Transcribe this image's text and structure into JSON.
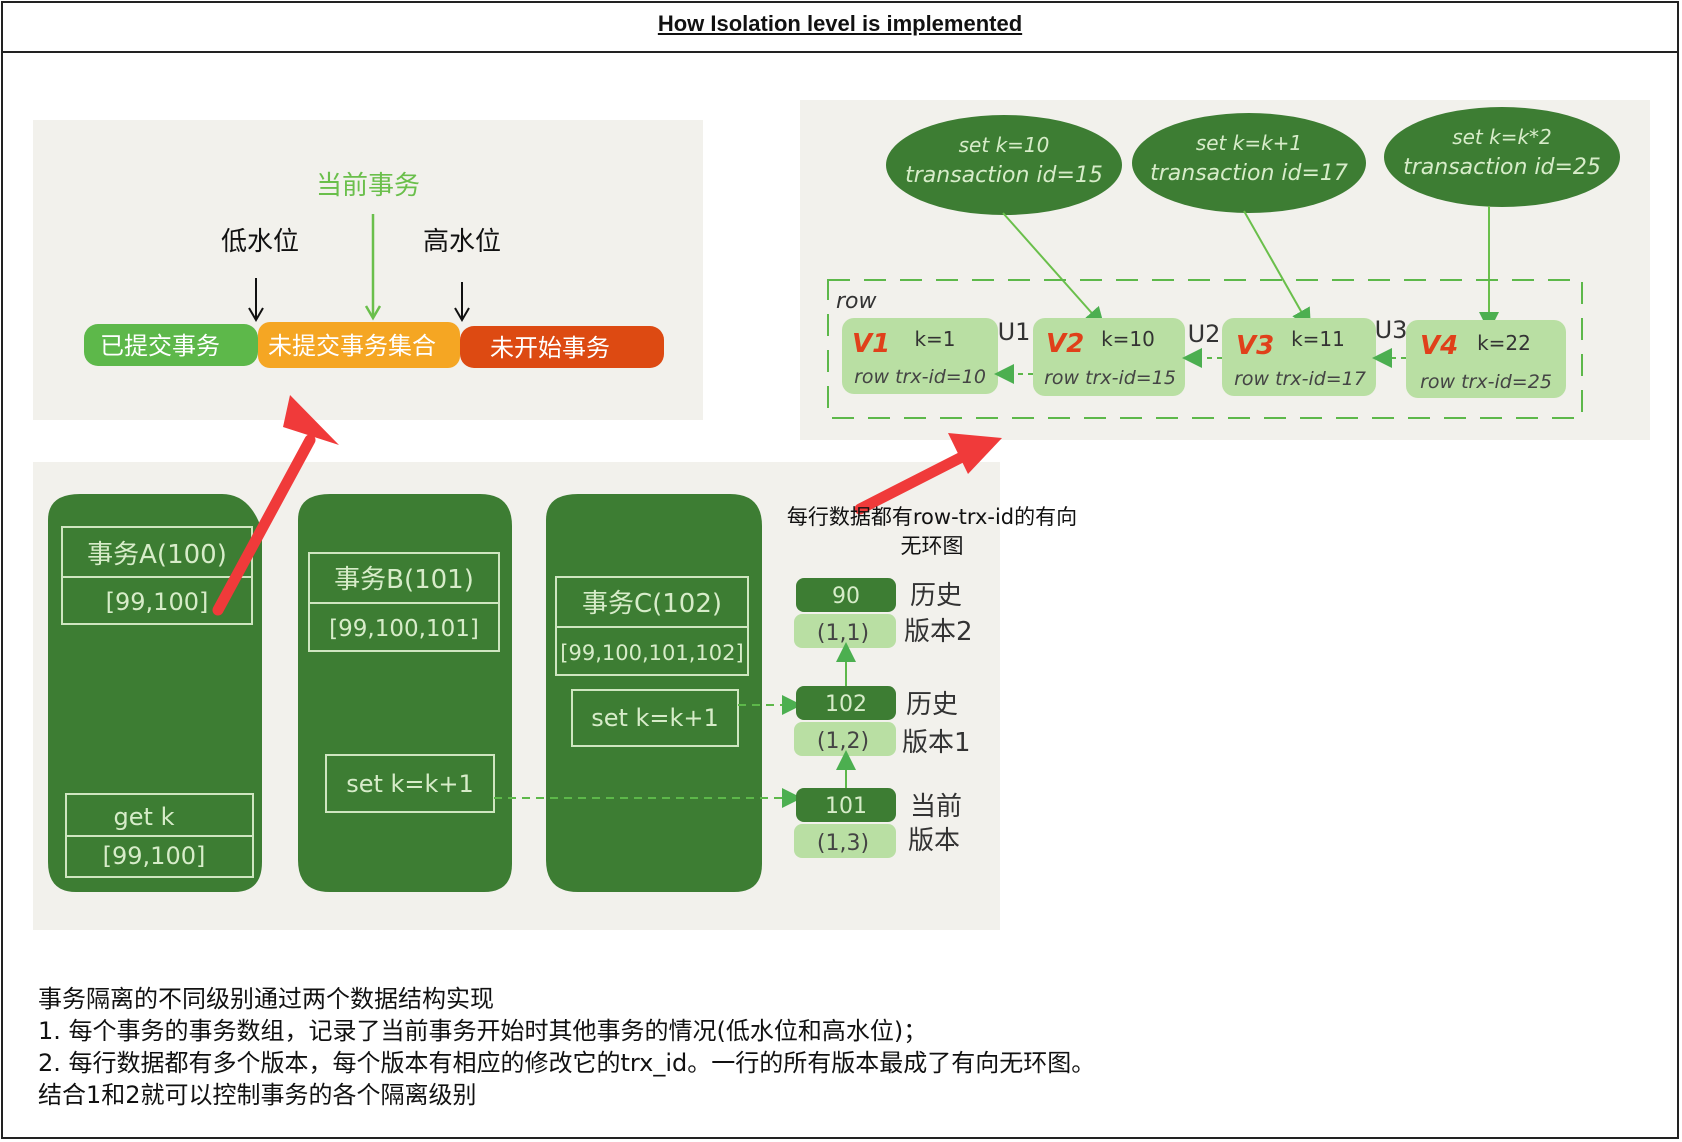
{
  "title": "How Isolation level is implemented",
  "watermark": {
    "labels": {
      "low": "低水位",
      "current": "当前事务",
      "high": "高水位"
    },
    "segments": [
      "已提交事务",
      "未提交事务集合",
      "未开始事务"
    ],
    "colors": {
      "committed": "#5db84a",
      "uncommitted": "#f5a623",
      "not_started": "#dd4a12"
    }
  },
  "versions": {
    "ops": [
      {
        "op": "set k=10",
        "tid": "transaction id=15"
      },
      {
        "op": "set k=k+1",
        "tid": "transaction id=17"
      },
      {
        "op": "set k=k*2",
        "tid": "transaction id=25"
      }
    ],
    "row_label": "row",
    "nodes": [
      {
        "v": "V1",
        "k": "k=1",
        "trx": "row trx-id=10"
      },
      {
        "v": "V2",
        "k": "k=10",
        "trx": "row trx-id=15"
      },
      {
        "v": "V3",
        "k": "k=11",
        "trx": "row trx-id=17"
      },
      {
        "v": "V4",
        "k": "k=22",
        "trx": "row trx-id=25"
      }
    ],
    "undo": [
      "U1",
      "U2",
      "U3"
    ]
  },
  "transactions": [
    {
      "name": "事务A(100)",
      "array": "[99,100]",
      "get_op": "get k",
      "get_result": "[99,100]"
    },
    {
      "name": "事务B(101)",
      "array": "[99,100,101]",
      "op": "set k=k+1"
    },
    {
      "name": "事务C(102)",
      "array": "[99,100,101,102]",
      "op": "set k=k+1"
    }
  ],
  "chain": [
    {
      "value": "90",
      "ver": "(1,1)",
      "label1": "历史",
      "label2": "版本2"
    },
    {
      "value": "102",
      "ver": "(1,2)",
      "label1": "历史",
      "label2": "版本1"
    },
    {
      "value": "101",
      "ver": "(1,3)",
      "label1": "当前",
      "label2": "版本"
    }
  ],
  "dag_note": "每行数据都有row-trx-id的有向无环图",
  "description": [
    "事务隔离的不同级别通过两个数据结构实现",
    "1. 每个事务的事务数组，记录了当前事务开始时其他事务的情况(低水位和高水位)；",
    "2. 每行数据都有多个版本，每个版本有相应的修改它的trx_id。一行的所有版本最成了有向无环图。",
    "结合1和2就可以控制事务的各个隔离级别"
  ]
}
